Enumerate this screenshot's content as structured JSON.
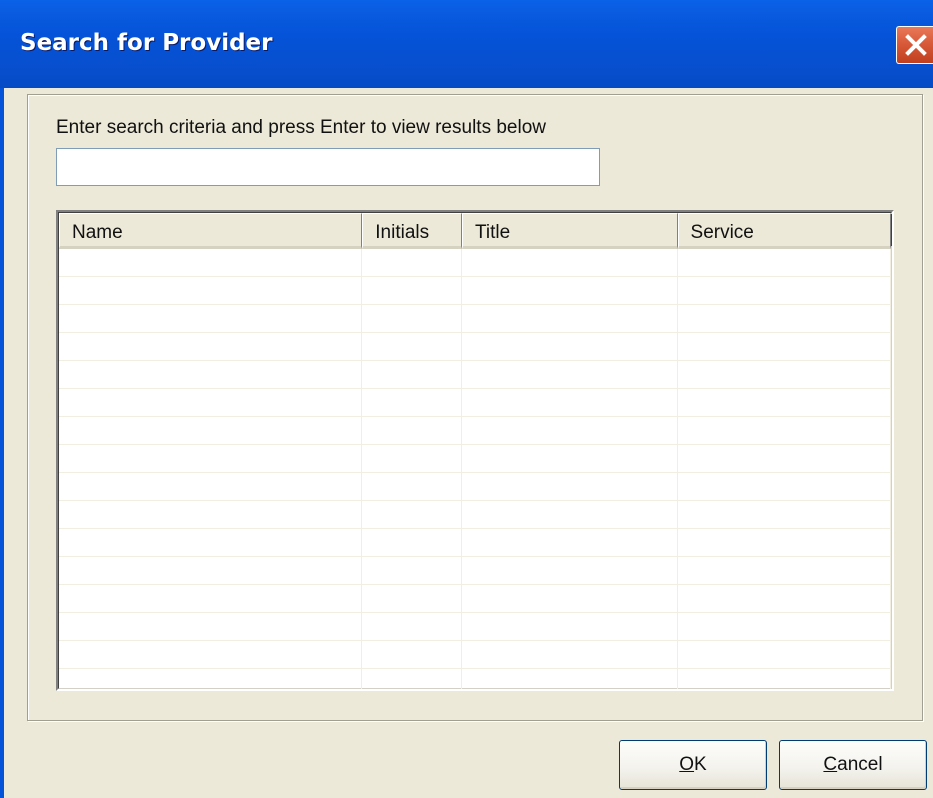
{
  "window": {
    "title": "Search for Provider"
  },
  "search": {
    "prompt": "Enter search criteria and press Enter to view results below",
    "value": "",
    "placeholder": ""
  },
  "results": {
    "columns": [
      "Name",
      "Initials",
      "Title",
      "Service"
    ],
    "rows": []
  },
  "buttons": {
    "ok_accel": "O",
    "ok_rest": "K",
    "cancel_accel": "C",
    "cancel_rest": "ancel"
  },
  "colors": {
    "titlebar": "#0553d8",
    "dialog_bg": "#ece9d8",
    "close_button": "#d85a3a"
  },
  "icons": {
    "close": "close-icon"
  }
}
